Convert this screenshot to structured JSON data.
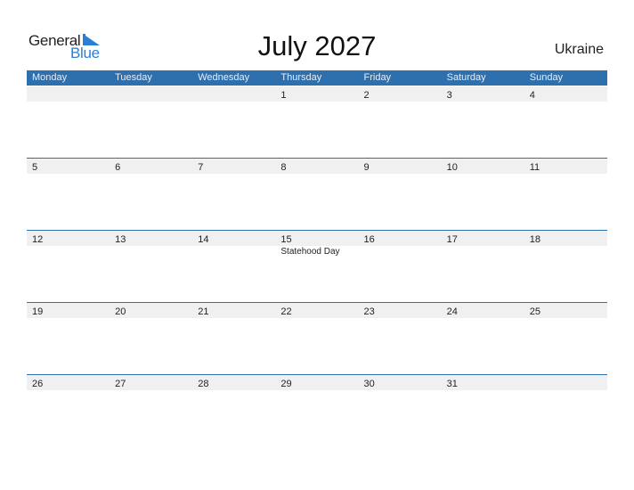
{
  "logo": {
    "general": "General",
    "blue": "Blue"
  },
  "title": "July 2027",
  "country": "Ukraine",
  "colors": {
    "accent": "#2e6fae",
    "band": "#f0f0f0",
    "logo_blue": "#2a7fd4"
  },
  "weekdays": [
    "Monday",
    "Tuesday",
    "Wednesday",
    "Thursday",
    "Friday",
    "Saturday",
    "Sunday"
  ],
  "weeks": [
    {
      "days": [
        "",
        "",
        "",
        "1",
        "2",
        "3",
        "4"
      ],
      "events": [
        "",
        "",
        "",
        "",
        "",
        "",
        ""
      ]
    },
    {
      "days": [
        "5",
        "6",
        "7",
        "8",
        "9",
        "10",
        "11"
      ],
      "events": [
        "",
        "",
        "",
        "",
        "",
        "",
        ""
      ]
    },
    {
      "days": [
        "12",
        "13",
        "14",
        "15",
        "16",
        "17",
        "18"
      ],
      "events": [
        "",
        "",
        "",
        "Statehood Day",
        "",
        "",
        ""
      ]
    },
    {
      "days": [
        "19",
        "20",
        "21",
        "22",
        "23",
        "24",
        "25"
      ],
      "events": [
        "",
        "",
        "",
        "",
        "",
        "",
        ""
      ]
    },
    {
      "days": [
        "26",
        "27",
        "28",
        "29",
        "30",
        "31",
        ""
      ],
      "events": [
        "",
        "",
        "",
        "",
        "",
        "",
        ""
      ]
    }
  ]
}
